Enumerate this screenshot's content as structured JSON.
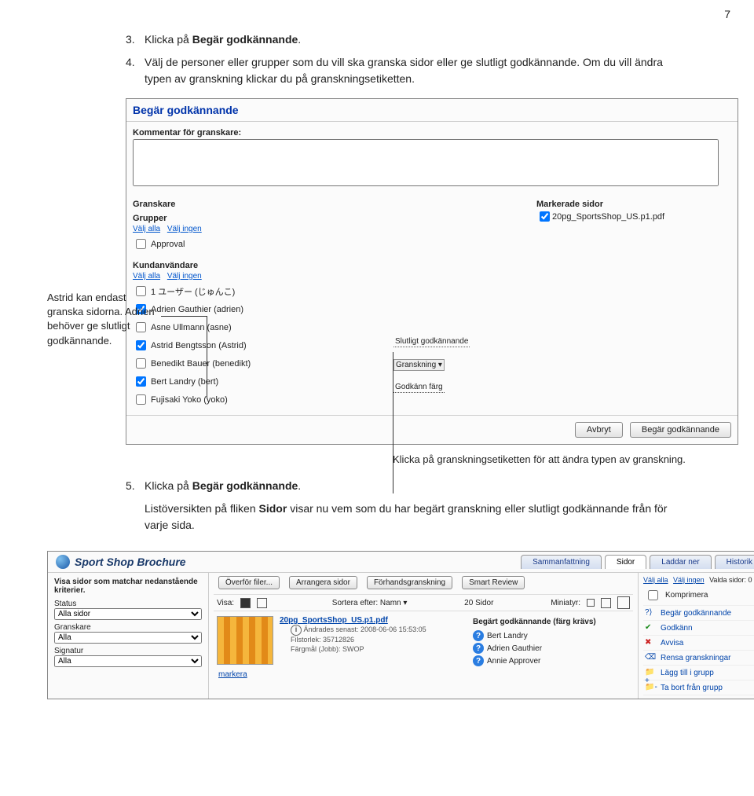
{
  "page_number": "7",
  "steps": {
    "s3": {
      "num": "3.",
      "prefix": "Klicka på ",
      "bold": "Begär godkännande",
      "suffix": "."
    },
    "s4": {
      "num": "4.",
      "text": "Välj de personer eller grupper som du vill ska granska sidor eller ge slutligt godkännande. Om du vill ändra typen av granskning klickar du på granskningsetiketten."
    },
    "s5": {
      "num": "5.",
      "prefix": "Klicka på ",
      "bold": "Begär godkännande",
      "suffix": "."
    },
    "s5b": {
      "prefix": "Listöversikten på fliken ",
      "bold": "Sidor",
      "suffix": " visar nu vem som du har begärt granskning eller slutligt godkännande från för varje sida."
    }
  },
  "annot_left": "Astrid kan endast granska sidorna. Adrien behöver ge slutligt godkännande.",
  "annot_bottom": "Klicka på granskningsetiketten för att ändra typen av granskning.",
  "shot1": {
    "title": "Begär godkännande",
    "comment_label": "Kommentar för granskare:",
    "granskare": "Granskare",
    "grupper": "Grupper",
    "kundanv": "Kundanvändare",
    "valj_alla": "Välj alla",
    "valj_ingen": "Välj ingen",
    "approval": "Approval",
    "users": [
      {
        "name": "1 ユーザー (じゅんこ)",
        "checked": false
      },
      {
        "name": "Adrien Gauthier (adrien)",
        "checked": true
      },
      {
        "name": "Asne Ullmann (asne)",
        "checked": false
      },
      {
        "name": "Astrid Bengtsson (Astrid)",
        "checked": true
      },
      {
        "name": "Benedikt Bauer (benedikt)",
        "checked": false
      },
      {
        "name": "Bert Landry (bert)",
        "checked": true
      },
      {
        "name": "Fujisaki Yoko (yoko)",
        "checked": false
      }
    ],
    "role_slutligt": "Slutligt godkännande",
    "role_granskning": "Granskning",
    "role_godkann_farg": "Godkänn färg",
    "markerade_sidor": "Markerade sidor",
    "marked_file": "20pg_SportsShop_US.p1.pdf",
    "btn_cancel": "Avbryt",
    "btn_request": "Begär godkännande"
  },
  "shot2": {
    "brand": "Sport Shop Brochure",
    "tabs": [
      "Sammanfattning",
      "Sidor",
      "Laddar ner",
      "Historik"
    ],
    "active_tab": 1,
    "left": {
      "heading": "Visa sidor som matchar nedanstående kriterier.",
      "status_label": "Status",
      "status_value": "Alla sidor",
      "granskare_label": "Granskare",
      "granskare_value": "Alla",
      "signatur_label": "Signatur",
      "signatur_value": "Alla"
    },
    "toolbar": [
      "Överför filer...",
      "Arrangera sidor",
      "Förhandsgranskning",
      "Smart Review"
    ],
    "visa_label": "Visa:",
    "sort_label": "Sortera efter: Namn ▾",
    "count": "20 Sidor",
    "mini_label": "Miniatyr:",
    "file": {
      "name": "20pg_SportsShop_US.p1.pdf",
      "m1": "Ändrades senast: 2008-06-06 15:53:05",
      "m2": "Filstorlek: 35712826",
      "m3": "Färgmål (Jobb): SWOP"
    },
    "approv": {
      "heading": "Begärt godkännande (färg krävs)",
      "rows": [
        "Bert Landry",
        "Adrien Gauthier",
        "Annie Approver"
      ]
    },
    "right": {
      "valj_alla": "Välj alla",
      "valj_ingen": "Välj ingen",
      "valda": "Valda sidor: 0",
      "komprimera": "Komprimera",
      "actions": [
        "Begär godkännande",
        "Godkänn",
        "Avvisa",
        "Rensa granskningar",
        "Lägg till i grupp",
        "Ta bort från grupp"
      ]
    },
    "markera": "markera"
  }
}
